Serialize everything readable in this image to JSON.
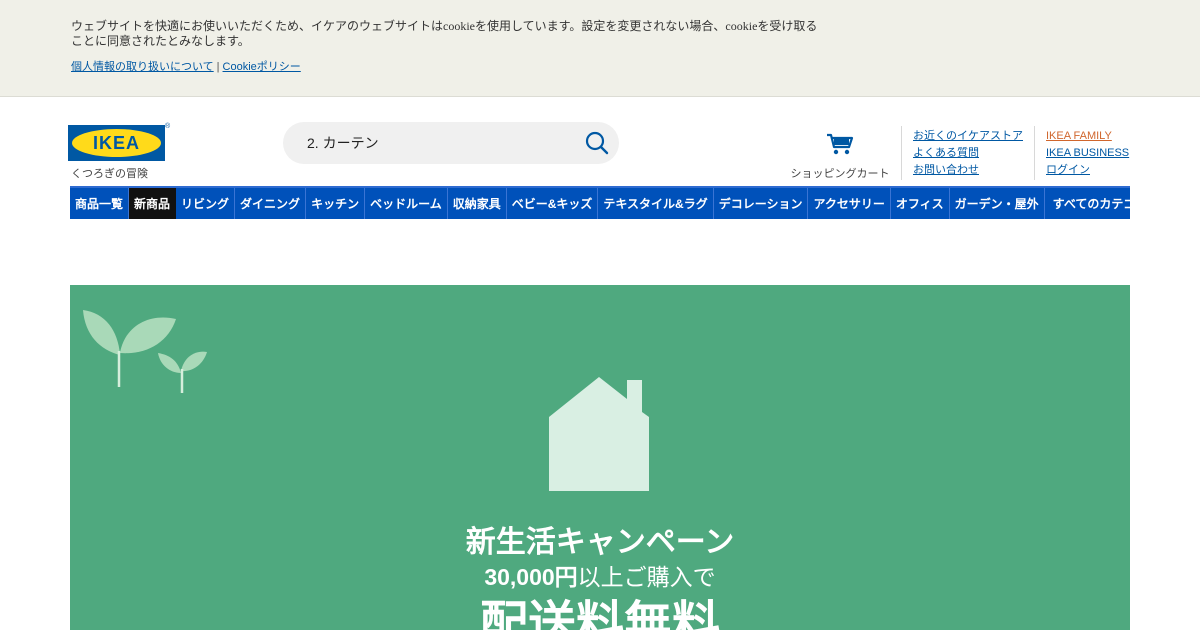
{
  "cookie": {
    "text": "ウェブサイトを快適にお使いいただくため、イケアのウェブサイトはcookieを使用しています。設定を変更されない場合、cookieを受け取ることに同意されたとみなします。",
    "privacy_link": "個人情報の取り扱いについて",
    "separator": "|",
    "cookie_policy_link": "Cookieポリシー"
  },
  "header": {
    "logo_text": "IKEA",
    "logo_reg": "®",
    "tagline": "くつろぎの冒険",
    "search": {
      "value": "2. カーテン",
      "icon": "search-icon"
    },
    "cart": {
      "label": "ショッピングカート",
      "icon": "cart-icon"
    },
    "links_left": [
      "お近くのイケアストア",
      "よくある質問",
      "お問い合わせ"
    ],
    "links_right": [
      "IKEA FAMILY",
      "IKEA BUSINESS",
      "ログイン"
    ]
  },
  "nav": {
    "items": [
      "商品一覧",
      "新商品",
      "リビング",
      "ダイニング",
      "キッチン",
      "ベッドルーム",
      "収納家具",
      "ベビー&キッズ",
      "テキスタイル&ラグ",
      "デコレーション",
      "アクセサリー",
      "オフィス",
      "ガーデン・屋外"
    ],
    "active_index": 1,
    "all_categories": "すべてのカテゴリ"
  },
  "hero": {
    "title": "新生活キャンペーン",
    "sub_amount": "30,000円",
    "sub_rest": "以上ご購入で",
    "big": "配送料無料",
    "bg_color": "#4fa97f"
  },
  "colors": {
    "brand_blue": "#0058a3",
    "brand_yellow": "#ffda1a",
    "nav_blue": "#0051ba",
    "family_orange": "#d0662d"
  }
}
